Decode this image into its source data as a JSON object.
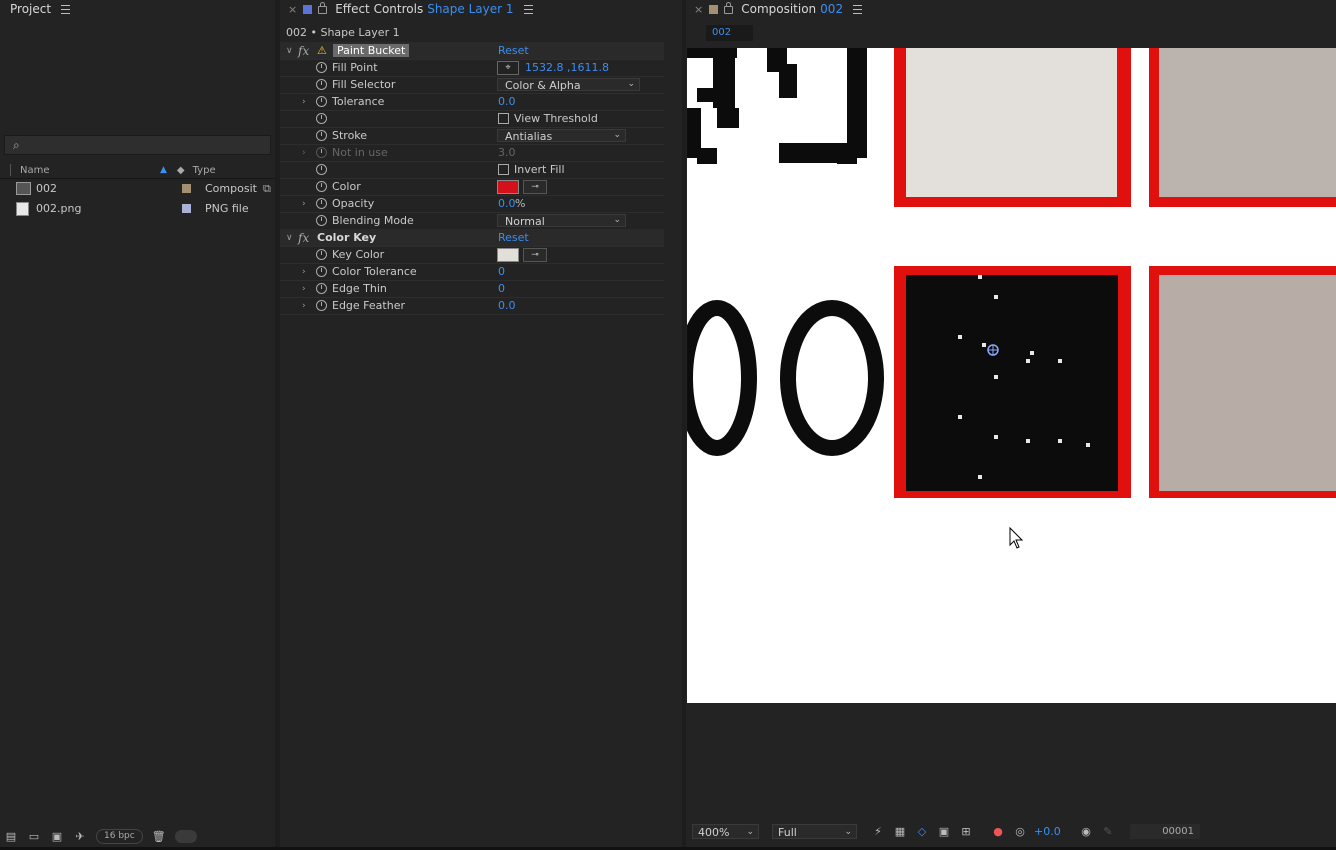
{
  "project": {
    "title": "Project",
    "columns": {
      "name": "Name",
      "type": "Type"
    },
    "items": [
      {
        "name": "002",
        "type": "Compositi",
        "label_color": "#a58f73"
      },
      {
        "name": "002.png",
        "type": "PNG file",
        "label_color": "#a9b2d6"
      }
    ],
    "bpc": "16 bpc"
  },
  "effects": {
    "title": "Effect Controls",
    "layer": "Shape Layer 1",
    "path": "002 • Shape Layer 1",
    "paint_bucket": {
      "name": "Paint Bucket",
      "reset": "Reset",
      "fill_point_label": "Fill Point",
      "fill_point_value": "1532.8 ,1611.8",
      "fill_selector_label": "Fill Selector",
      "fill_selector_value": "Color & Alpha",
      "tolerance_label": "Tolerance",
      "tolerance_value": "0.0",
      "view_threshold": "View Threshold",
      "stroke_label": "Stroke",
      "stroke_value": "Antialias",
      "not_in_use_label": "Not in use",
      "not_in_use_value": "3.0",
      "invert_fill": "Invert Fill",
      "color_label": "Color",
      "color": "#d4101a",
      "opacity_label": "Opacity",
      "opacity_value": "0.0",
      "opacity_unit": "%",
      "blending_label": "Blending Mode",
      "blending_value": "Normal"
    },
    "color_key": {
      "name": "Color Key",
      "reset": "Reset",
      "key_color_label": "Key Color",
      "key_color": "#e2deda",
      "color_tolerance_label": "Color Tolerance",
      "color_tolerance_value": "0",
      "edge_thin_label": "Edge Thin",
      "edge_thin_value": "0",
      "edge_feather_label": "Edge Feather",
      "edge_feather_value": "0.0"
    }
  },
  "comp": {
    "title": "Composition",
    "name": "002",
    "tab": "002",
    "zoom": "400%",
    "resolution": "Full",
    "exposure": "+0.0",
    "frame": "00001",
    "frame_red": "#e0100e",
    "tile_light": "#e3dfdb",
    "tile_gray": "#bbb3ae",
    "tile_gray2": "#b8aca6",
    "tile_dark": "#0c0c0c"
  }
}
